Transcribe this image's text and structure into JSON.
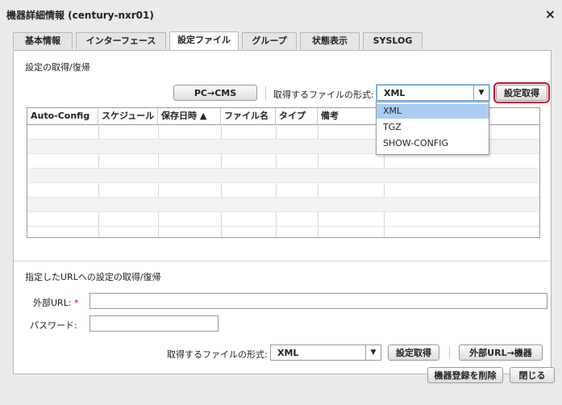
{
  "window": {
    "title": "機器詳細情報 (century-nxr01)",
    "close_label": "×"
  },
  "tabs": [
    {
      "label": "基本情報"
    },
    {
      "label": "インターフェース"
    },
    {
      "label": "設定ファイル"
    },
    {
      "label": "グループ"
    },
    {
      "label": "状態表示"
    },
    {
      "label": "SYSLOG"
    }
  ],
  "section1": {
    "title": "設定の取得/復帰",
    "pc_cms_button": "PC→CMS",
    "format_label": "取得するファイルの形式:",
    "format_value": "XML",
    "get_button": "設定取得",
    "columns": [
      "Auto-Config",
      "スケジュール",
      "保存日時 ▲",
      "ファイル名",
      "タイプ",
      "備考"
    ],
    "dropdown_options": [
      "XML",
      "TGZ",
      "SHOW-CONFIG"
    ]
  },
  "section2": {
    "title": "指定したURLへの設定の取得/復帰",
    "url_label": "外部URL:",
    "required_mark": "*",
    "url_value": "",
    "password_label": "パスワード:",
    "password_value": "",
    "format_label": "取得するファイルの形式:",
    "format_value": "XML",
    "get_button": "設定取得",
    "url_to_device_button": "外部URL→機器"
  },
  "footer": {
    "delete_button": "機器登録を削除",
    "close_button": "閉じる"
  },
  "colors": {
    "highlight": "#c8102e",
    "dropdown_selected": "#a9cdf2"
  }
}
